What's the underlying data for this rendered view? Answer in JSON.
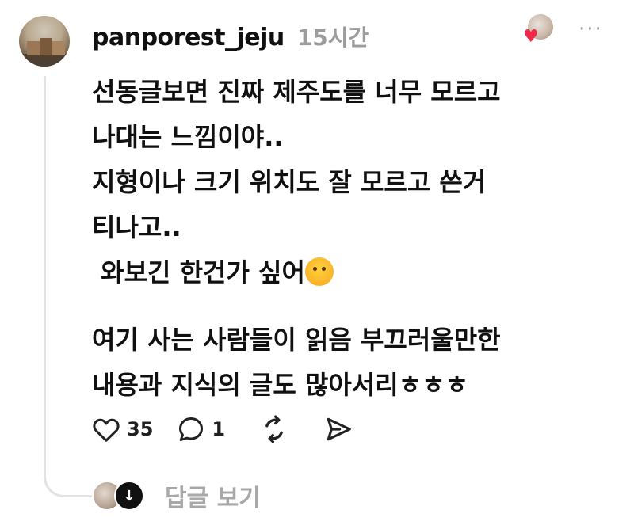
{
  "post": {
    "username": "panporest_jeju",
    "timestamp": "15시간",
    "more_label": "···",
    "lines": [
      "선동글보면 진짜 제주도를 너무 모르고",
      "나대는 느낌이야..",
      "지형이나 크기 위치도 잘 모르고 쓴거",
      "티나고..",
      " 와보긴 한건가 싶어"
    ],
    "emoji_icon": "melting-face-emoji",
    "lines2": [
      "여기 사는 사람들이 읽음 부끄러울만한",
      "내용과 지식의 글도 많아서리ㅎㅎㅎ"
    ]
  },
  "actions": {
    "like_count": "35",
    "reply_count": "1",
    "icons": [
      "heart-icon",
      "comment-icon",
      "repost-icon",
      "share-icon"
    ]
  },
  "replies": {
    "view_label": "답글 보기"
  },
  "colors": {
    "text": "#101010",
    "muted": "#9c9c9c",
    "like_heart": "#f0284a",
    "thread_line": "#e3e3e3"
  }
}
